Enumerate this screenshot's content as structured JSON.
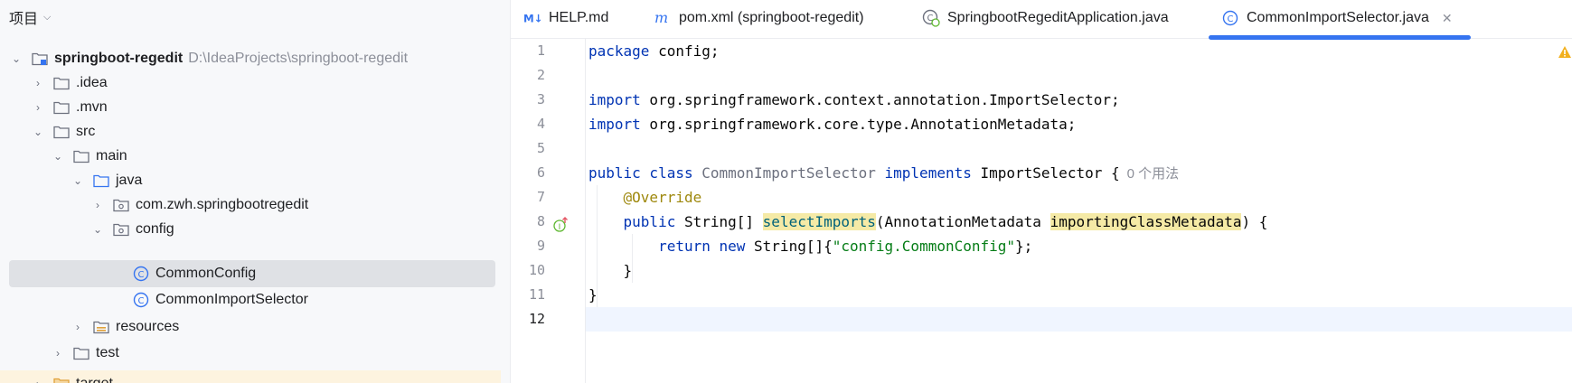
{
  "panel": {
    "title": "项目",
    "tree": [
      {
        "label": "springboot-regedit",
        "path": "D:\\IdeaProjects\\springboot-regedit"
      },
      {
        "label": ".idea"
      },
      {
        "label": ".mvn"
      },
      {
        "label": "src"
      },
      {
        "label": "main"
      },
      {
        "label": "java"
      },
      {
        "label": "com.zwh.springbootregedit"
      },
      {
        "label": "config"
      },
      {
        "label": "CommonConfig"
      },
      {
        "label": "CommonImportSelector"
      },
      {
        "label": "resources"
      },
      {
        "label": "test"
      },
      {
        "label": "target"
      }
    ]
  },
  "tabs": [
    {
      "label": "HELP.md",
      "icon": "markdown-icon"
    },
    {
      "label": "pom.xml (springboot-regedit)",
      "icon": "maven-icon"
    },
    {
      "label": "SpringbootRegeditApplication.java",
      "icon": "spring-class-icon"
    },
    {
      "label": "CommonImportSelector.java",
      "icon": "class-icon"
    }
  ],
  "editor": {
    "line_numbers": [
      "1",
      "2",
      "3",
      "4",
      "5",
      "6",
      "7",
      "8",
      "9",
      "10",
      "11",
      "12"
    ],
    "code": {
      "l1_kw": "package",
      "l1_rest": " config;",
      "l3_kw": "import",
      "l3_rest": " org.springframework.context.annotation.ImportSelector;",
      "l4_kw": "import",
      "l4_rest": " org.springframework.core.type.AnnotationMetadata;",
      "l6_kw1": "public class ",
      "l6_cls": "CommonImportSelector",
      "l6_kw2": " implements ",
      "l6_rest": "ImportSelector {",
      "l6_hint": "0 个用法",
      "l7_ann": "@Override",
      "l8_kw": "public ",
      "l8_type": "String[] ",
      "l8_meth": "selectImports",
      "l8_p1": "(AnnotationMetadata ",
      "l8_param": "importingClassMetadata",
      "l8_p2": ") {",
      "l9_kw1": "return ",
      "l9_kw2": "new ",
      "l9_type": "String[]{",
      "l9_str": "\"config.CommonConfig\"",
      "l9_end": "};",
      "l10": "}",
      "l11": "}"
    }
  },
  "colors": {
    "accent": "#3574f0",
    "keyword": "#0033b3",
    "annotation": "#9e880d",
    "string": "#067d17",
    "warning": "#f2b01e"
  }
}
